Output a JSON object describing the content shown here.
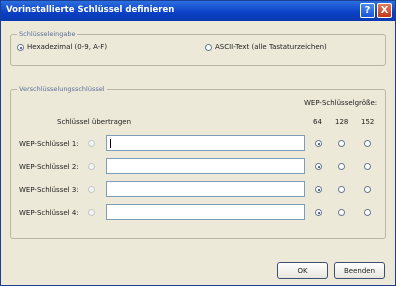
{
  "window": {
    "title": "Vorinstallierte Schlüssel definieren"
  },
  "titlebar_buttons": {
    "help": "?",
    "close": "X"
  },
  "input_group": {
    "label": "Schlüsseleingabe",
    "options": [
      {
        "label": "Hexadezimal (0-9, A-F)",
        "selected": true
      },
      {
        "label": "ASCII-Text (alle Tastaturzeichen)",
        "selected": false
      }
    ]
  },
  "keys_group": {
    "label": "Verschlüsselungsschlüssel",
    "transmit_label": "Schlüssel übertragen",
    "size_label": "WEP-Schlüsselgröße:",
    "size_options": [
      "64",
      "128",
      "152"
    ],
    "rows": [
      {
        "label": "WEP-Schlüssel 1:",
        "value": "",
        "size": "64",
        "has_caret": true
      },
      {
        "label": "WEP-Schlüssel 2:",
        "value": "",
        "size": "64",
        "has_caret": false
      },
      {
        "label": "WEP-Schlüssel 3:",
        "value": "",
        "size": "64",
        "has_caret": false
      },
      {
        "label": "WEP-Schlüssel 4:",
        "value": "",
        "size": "64",
        "has_caret": false
      }
    ]
  },
  "buttons": {
    "ok": "OK",
    "cancel": "Beenden"
  }
}
